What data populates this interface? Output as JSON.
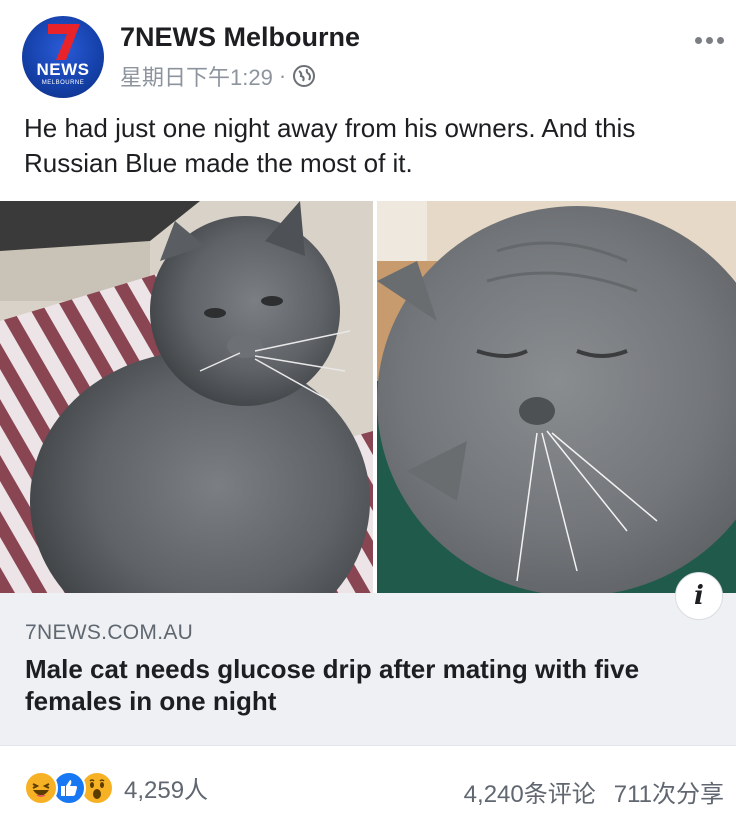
{
  "header": {
    "page_name": "7NEWS Melbourne",
    "timestamp": "星期日下午1:29",
    "separator": "·",
    "avatar_logo_text": "NEWS",
    "avatar_logo_subtext": "MELBOURNE",
    "brand_color": "#1440a8"
  },
  "post": {
    "text": "He had just one night away from his owners. And this Russian Blue made the most of it."
  },
  "photos": [
    {
      "icon": "cat-photo",
      "subject": "grey cat on striped blanket"
    },
    {
      "icon": "cat-photo",
      "subject": "grey cat sleeping close-up"
    }
  ],
  "link": {
    "domain": "7NEWS.COM.AU",
    "title": "Male cat needs glucose drip after mating with five females in one night",
    "info_label": "i"
  },
  "footer": {
    "reaction_count": "4,259人",
    "comments": "4,240条评论",
    "shares": "711次分享",
    "reactions": [
      "haha",
      "like",
      "wow"
    ]
  }
}
